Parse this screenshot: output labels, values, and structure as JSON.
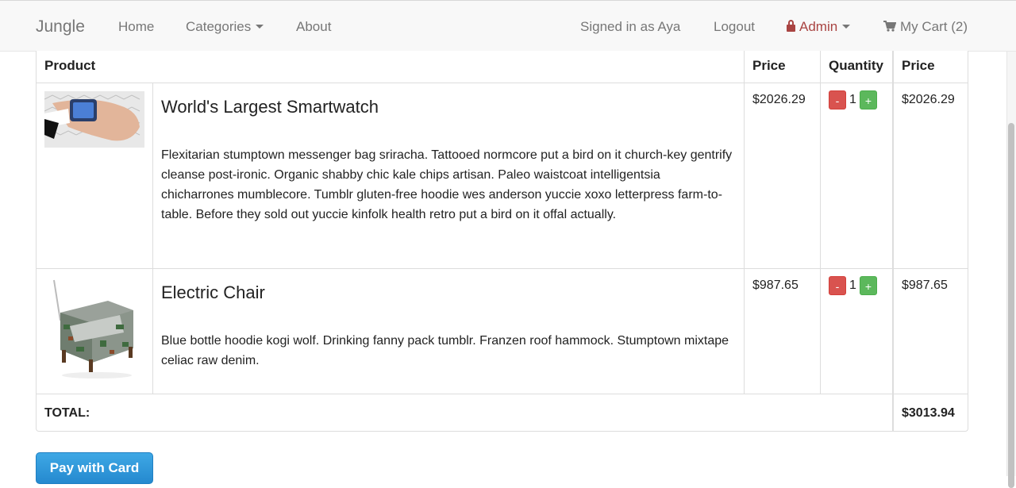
{
  "navbar": {
    "brand": "Jungle",
    "home": "Home",
    "categories": "Categories",
    "about": "About",
    "signed_in": "Signed in as Aya",
    "logout": "Logout",
    "admin": "Admin",
    "cart": "My Cart (2)",
    "admin_color": "#a94442"
  },
  "table": {
    "headers": {
      "product": "Product",
      "price": "Price",
      "quantity": "Quantity",
      "line_price": "Price"
    },
    "rows": [
      {
        "title": "World's Largest Smartwatch",
        "description": "Flexitarian stumptown messenger bag sriracha. Tattooed normcore put a bird on it church-key gentrify cleanse post-ironic. Organic shabby chic kale chips artisan. Paleo waistcoat intelligentsia chicharrones mumblecore. Tumblr gluten-free hoodie wes anderson yuccie xoxo letterpress farm-to-table. Before they sold out yuccie kinfolk health retro put a bird on it offal actually.",
        "price": "$2026.29",
        "quantity": "1",
        "line_price": "$2026.29",
        "minus": "-",
        "plus": "+"
      },
      {
        "title": "Electric Chair",
        "description": "Blue bottle hoodie kogi wolf. Drinking fanny pack tumblr. Franzen roof hammock. Stumptown mixtape celiac raw denim.",
        "price": "$987.65",
        "quantity": "1",
        "line_price": "$987.65",
        "minus": "-",
        "plus": "+"
      }
    ],
    "total_label": "TOTAL:",
    "total_value": "$3013.94"
  },
  "pay_button": "Pay with Card",
  "colors": {
    "minus": "#d9534f",
    "plus": "#5cb85c",
    "pay": "#2589cf"
  }
}
